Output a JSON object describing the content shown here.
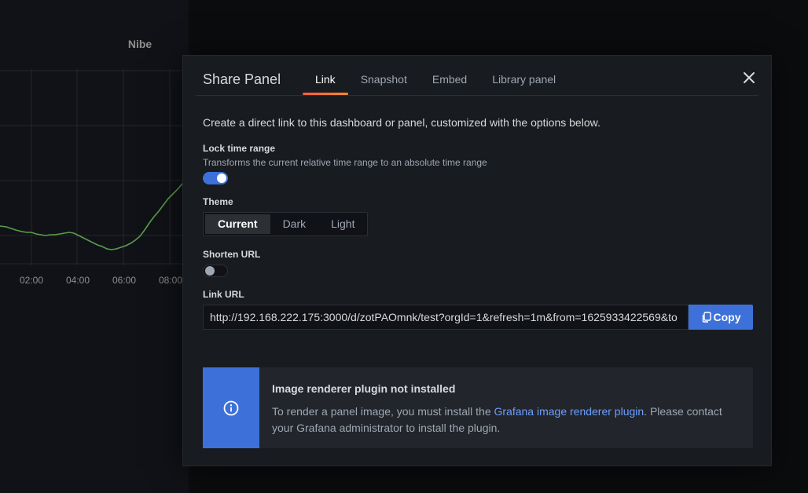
{
  "background": {
    "panel_title": "Nibe",
    "x_ticks": [
      "02:00",
      "04:00",
      "06:00",
      "08:00"
    ]
  },
  "modal": {
    "title": "Share Panel",
    "tabs": [
      {
        "label": "Link",
        "active": true
      },
      {
        "label": "Snapshot",
        "active": false
      },
      {
        "label": "Embed",
        "active": false
      },
      {
        "label": "Library panel",
        "active": false
      }
    ],
    "close_icon": "close-icon"
  },
  "link_tab": {
    "description": "Create a direct link to this dashboard or panel, customized with the options below.",
    "lock_time": {
      "label": "Lock time range",
      "sublabel": "Transforms the current relative time range to an absolute time range",
      "enabled": true
    },
    "theme": {
      "label": "Theme",
      "options": [
        "Current",
        "Dark",
        "Light"
      ],
      "selected": "Current"
    },
    "shorten_url": {
      "label": "Shorten URL",
      "enabled": false
    },
    "link_url": {
      "label": "Link URL",
      "value": "http://192.168.222.175:3000/d/zotPAOmnk/test?orgId=1&refresh=1m&from=1625933422569&to",
      "copy_label": "Copy",
      "copy_icon": "copy-icon"
    }
  },
  "alert": {
    "icon": "info-circle-icon",
    "title": "Image renderer plugin not installed",
    "body_before": "To render a panel image, you must install the ",
    "link_text": "Grafana image renderer plugin",
    "body_after": ". Please contact your Grafana administrator to install the plugin."
  },
  "colors": {
    "primary": "#3d71d9",
    "tab_underline": "#ff8833",
    "link": "#6e9fff",
    "modal_bg": "#181b1f",
    "series": "#5a9e4b"
  }
}
